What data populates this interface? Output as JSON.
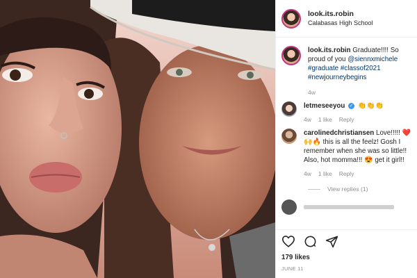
{
  "post": {
    "username": "look.its.robin",
    "location": "Calabasas High School"
  },
  "caption": {
    "username": "look.its.robin",
    "text": "Graduate!!!! So proud of you",
    "mention": "@siennxmichele",
    "hashtags": "#graduate #classof2021 #newjourneybegins",
    "time": "4w"
  },
  "comments": [
    {
      "username": "letmeseeyou",
      "verified": true,
      "emoji": "👏👏👏",
      "time": "4w",
      "likes": "1 like",
      "reply": "Reply"
    },
    {
      "username": "carolinedchristiansen",
      "text_start": "Love!!!!!",
      "text_mid": "this is all the feelz! Gosh I remember when she was so little!! Also, hot momma!!!",
      "text_end": "get it girl!!",
      "emoji_a": "❤️🙌🔥",
      "emoji_b": "😍",
      "time": "4w",
      "likes": "1 like",
      "reply": "Reply",
      "view_replies": "View replies (1)"
    }
  ],
  "actions": {
    "likes": "179 likes",
    "date": "JUNE 11"
  },
  "icons": {
    "like": "heart-icon",
    "comment": "comment-icon",
    "share": "share-icon"
  }
}
